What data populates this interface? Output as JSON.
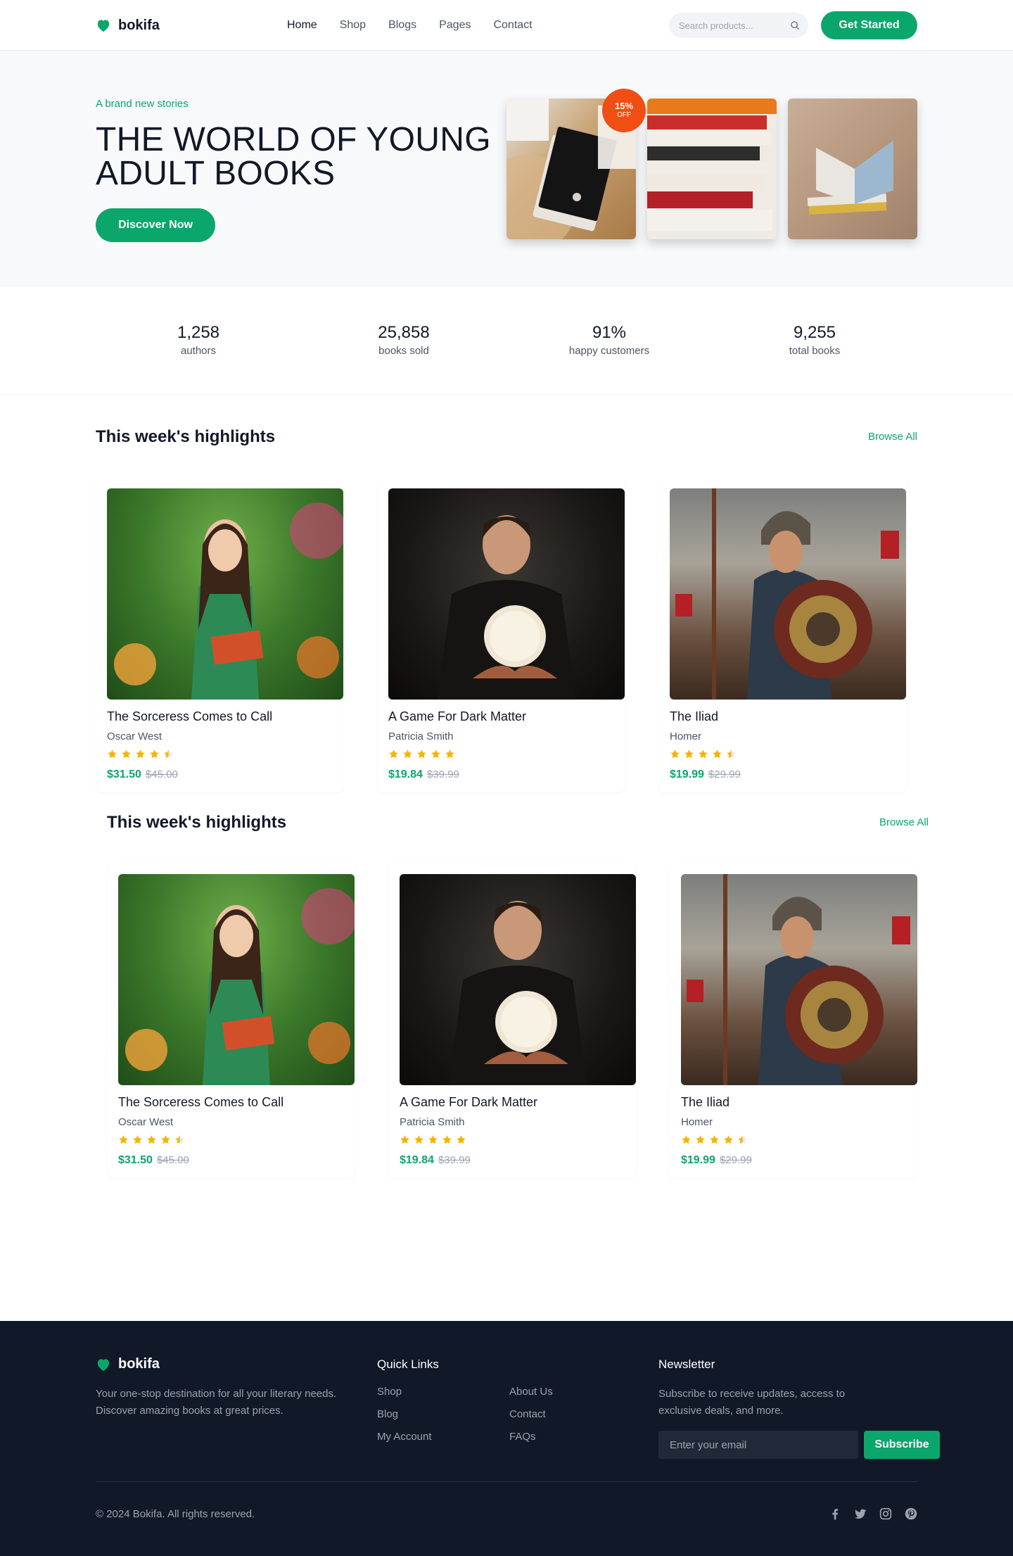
{
  "brand": {
    "name": "bokifa",
    "accent": "#0aa66b"
  },
  "nav": {
    "items": [
      "Home",
      "Shop",
      "Blogs",
      "Pages",
      "Contact"
    ],
    "active": "Home"
  },
  "search": {
    "placeholder": "Search products..."
  },
  "header_cta": "Get Started",
  "hero": {
    "tagline": "A brand new stories",
    "title": "THE WORLD OF YOUNG ADULT BOOKS",
    "cta": "Discover Now",
    "badge": {
      "percent": "15%",
      "label": "OFF"
    }
  },
  "stats": [
    {
      "value": "1,258",
      "label": "authors"
    },
    {
      "value": "25,858",
      "label": "books sold"
    },
    {
      "value": "91%",
      "label": "happy customers"
    },
    {
      "value": "9,255",
      "label": "total books"
    }
  ],
  "highlights": [
    {
      "title": "This week's highlights",
      "browse": "Browse All",
      "books": [
        {
          "title": "The Sorceress Comes to Call",
          "author": "Oscar West",
          "rating": 4.5,
          "price": "$31.50",
          "old_price": "$45.00"
        },
        {
          "title": "A Game For Dark Matter",
          "author": "Patricia Smith",
          "rating": 5,
          "price": "$19.84",
          "old_price": "$39.99"
        },
        {
          "title": "The Iliad",
          "author": "Homer",
          "rating": 4.5,
          "price": "$19.99",
          "old_price": "$29.99"
        }
      ]
    },
    {
      "title": "This week's highlights",
      "browse": "Browse All",
      "books": [
        {
          "title": "The Sorceress Comes to Call",
          "author": "Oscar West",
          "rating": 4.5,
          "price": "$31.50",
          "old_price": "$45.00"
        },
        {
          "title": "A Game For Dark Matter",
          "author": "Patricia Smith",
          "rating": 5,
          "price": "$19.84",
          "old_price": "$39.99"
        },
        {
          "title": "The Iliad",
          "author": "Homer",
          "rating": 4.5,
          "price": "$19.99",
          "old_price": "$29.99"
        }
      ]
    }
  ],
  "footer": {
    "brand": "bokifa",
    "description": "Your one-stop destination for all your literary needs. Discover amazing books at great prices.",
    "quick_links_title": "Quick Links",
    "links_col1": [
      "Shop",
      "Blog",
      "My Account"
    ],
    "links_col2": [
      "About Us",
      "Contact",
      "FAQs"
    ],
    "newsletter_title": "Newsletter",
    "newsletter_text": "Subscribe to receive updates, access to exclusive deals, and more.",
    "email_placeholder": "Enter your email",
    "subscribe": "Subscribe",
    "copyright": "© 2024 Bokifa. All rights reserved.",
    "socials": [
      "facebook-icon",
      "twitter-icon",
      "instagram-icon",
      "pinterest-icon"
    ]
  }
}
